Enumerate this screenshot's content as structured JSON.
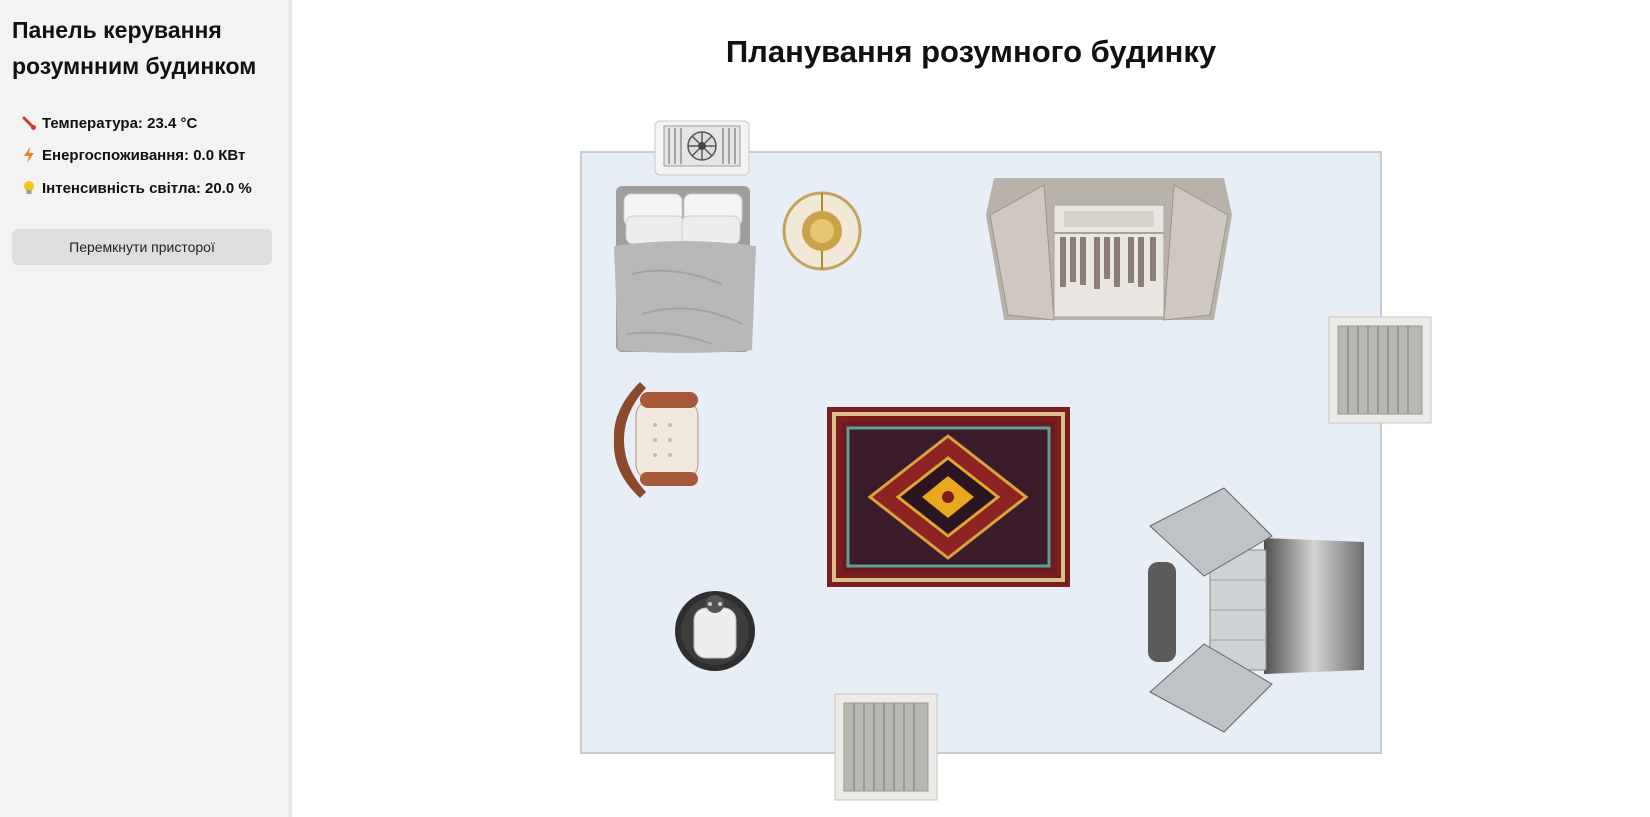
{
  "sidebar": {
    "title": "Панель керування розумнним будинком",
    "metrics": [
      {
        "icon": "thermometer-icon",
        "text": "Температура: 23.4 °C"
      },
      {
        "icon": "lightning-icon",
        "text": "Енергоспоживання: 0.0 КВт"
      },
      {
        "icon": "lightbulb-icon",
        "text": "Інтенсивність світла: 20.0 %"
      }
    ],
    "toggle_button": "Перемкнути присторої"
  },
  "main": {
    "title": "Планування розумного будинку"
  },
  "colors": {
    "sidebar_bg": "#f3f3f3",
    "room_floor": "#e8eef5",
    "button_bg": "#dedede"
  }
}
